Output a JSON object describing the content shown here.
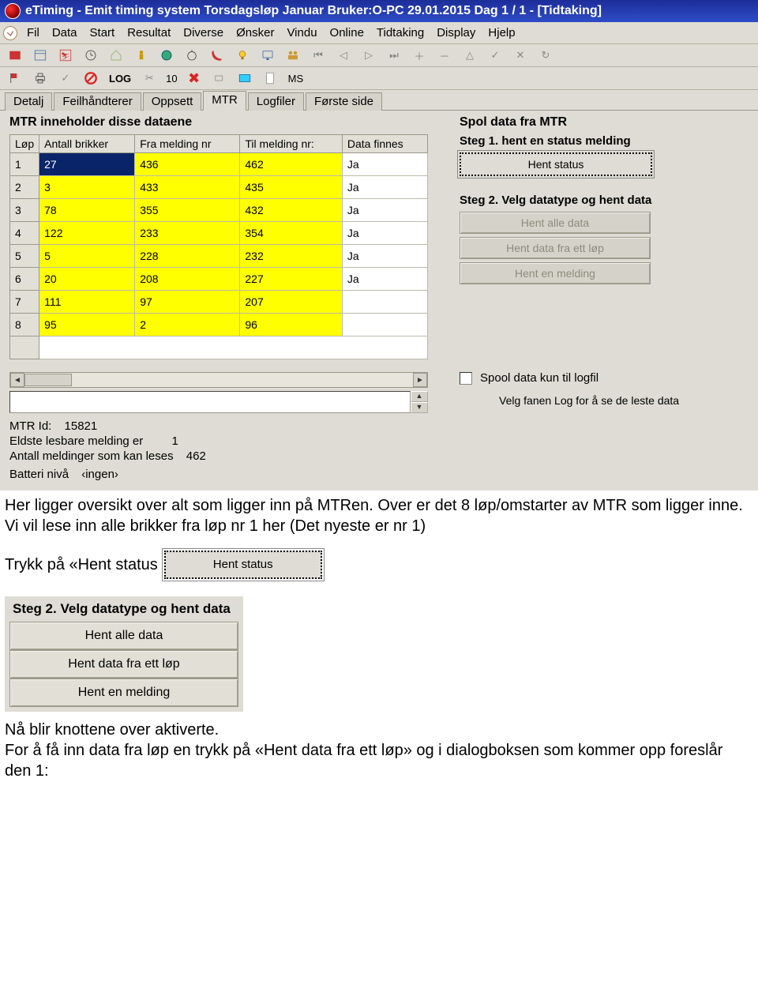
{
  "title": "eTiming - Emit timing system  Torsdagsløp Januar  Bruker:O-PC  29.01.2015  Dag 1 / 1 - [Tidtaking]",
  "menubar": [
    "Fil",
    "Data",
    "Start",
    "Resultat",
    "Diverse",
    "Ønsker",
    "Vindu",
    "Online",
    "Tidtaking",
    "Display",
    "Hjelp"
  ],
  "toolbar2": {
    "log": "LOG",
    "num": "10",
    "ms": "MS"
  },
  "tabs": [
    "Detalj",
    "Feilhåndterer",
    "Oppsett",
    "MTR",
    "Logfiler",
    "Første side"
  ],
  "active_tab_index": 3,
  "mtr_panel": {
    "left_title": "MTR inneholder disse dataene",
    "columns": [
      "Løp",
      "Antall brikker",
      "Fra melding nr",
      "Til melding nr:",
      "Data finnes"
    ],
    "rows": [
      {
        "lop": "1",
        "antall": "27",
        "fra": "436",
        "til": "462",
        "finnes": "Ja",
        "selected": true
      },
      {
        "lop": "2",
        "antall": "3",
        "fra": "433",
        "til": "435",
        "finnes": "Ja"
      },
      {
        "lop": "3",
        "antall": "78",
        "fra": "355",
        "til": "432",
        "finnes": "Ja"
      },
      {
        "lop": "4",
        "antall": "122",
        "fra": "233",
        "til": "354",
        "finnes": "Ja"
      },
      {
        "lop": "5",
        "antall": "5",
        "fra": "228",
        "til": "232",
        "finnes": "Ja"
      },
      {
        "lop": "6",
        "antall": "20",
        "fra": "208",
        "til": "227",
        "finnes": "Ja"
      },
      {
        "lop": "7",
        "antall": "111",
        "fra": "97",
        "til": "207",
        "finnes": ""
      },
      {
        "lop": "8",
        "antall": "95",
        "fra": "2",
        "til": "96",
        "finnes": ""
      }
    ],
    "info": {
      "id_label": "MTR Id:",
      "id_value": "15821",
      "oldest_label": "Eldste lesbare melding er",
      "oldest_value": "1",
      "count_label": "Antall meldinger som kan leses",
      "count_value": "462",
      "battery_label": "Batteri nivå",
      "battery_value": "‹ingen›"
    },
    "right_title": "Spol data fra MTR",
    "step1_label": "Steg 1. hent en status melding",
    "hent_status": "Hent status",
    "step2_label": "Steg 2. Velg datatype og hent data",
    "btn_all": "Hent alle data",
    "btn_one": "Hent data fra ett løp",
    "btn_msg": "Hent en melding",
    "checkbox_label": "Spool data kun til logfil",
    "note": "Velg fanen Log for å se de leste data"
  },
  "doc": {
    "p1a": "Her ligger oversikt over alt som ligger inn på MTRen. Over er det 8 løp/omstarter av MTR som ligger inne.",
    "p1b": "Vi vil lese inn alle brikker fra løp nr 1 her (Det nyeste er nr 1)",
    "p2_prefix": "Trykk på «Hent status",
    "standalone_hent_status": "Hent status",
    "steg2_hdr": "Steg 2. Velg datatype og hent data",
    "steg2_btn1": "Hent alle data",
    "steg2_btn2": "Hent data fra ett løp",
    "steg2_btn3": "Hent en melding",
    "p3a": "Nå blir knottene over aktiverte.",
    "p3b": "For å få inn data fra løp en trykk på «Hent data fra ett løp» og i dialogboksen som kommer opp foreslår den 1:"
  }
}
